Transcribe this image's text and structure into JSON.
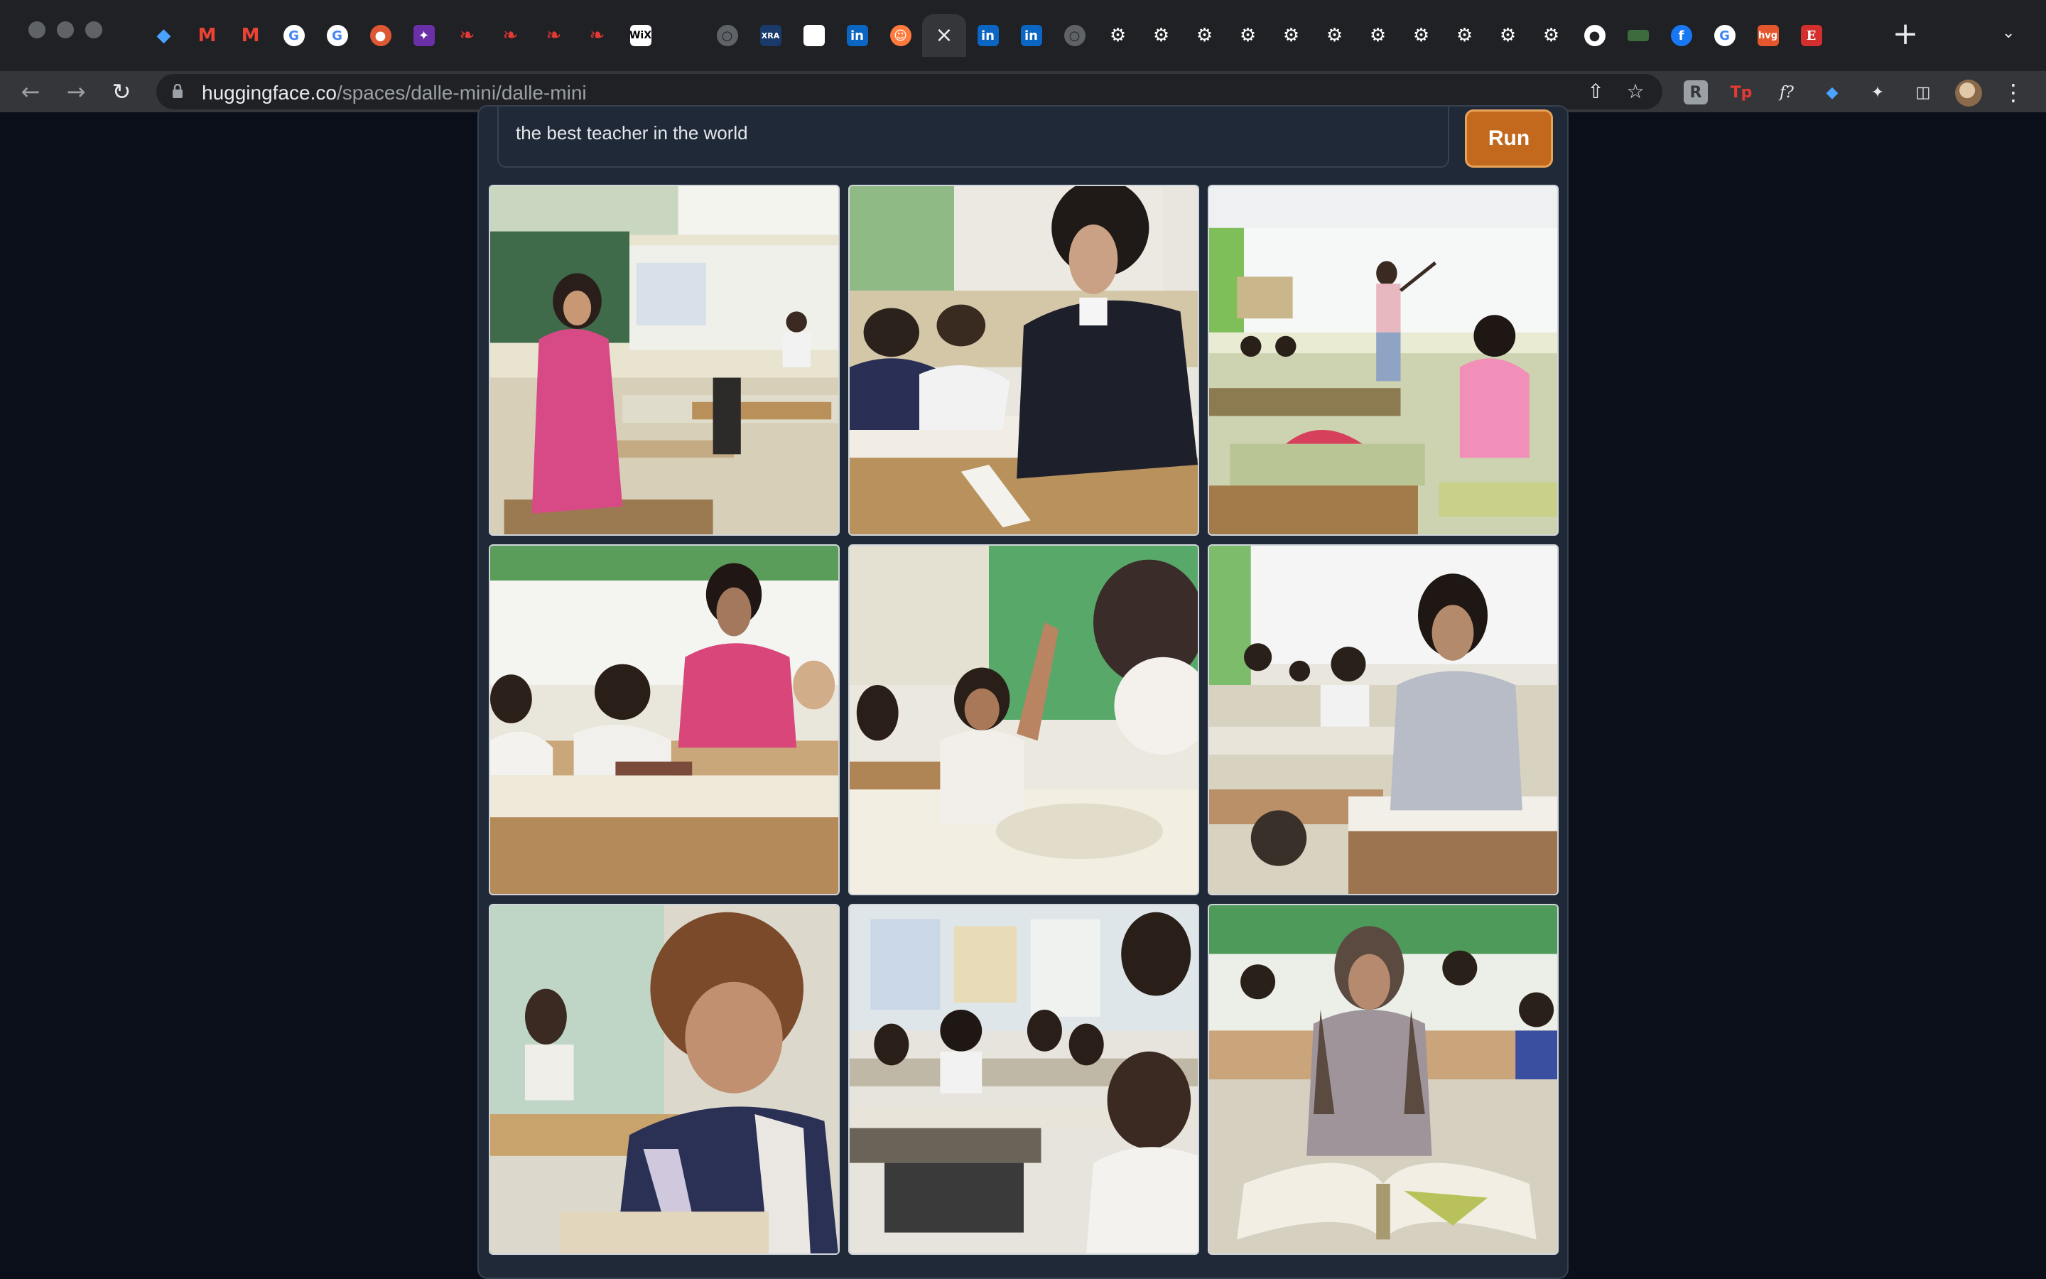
{
  "browser": {
    "tabs": [
      {
        "icon": "gem-icon"
      },
      {
        "icon": "gmail-icon"
      },
      {
        "icon": "gmail-icon"
      },
      {
        "icon": "google-icon"
      },
      {
        "icon": "google-icon"
      },
      {
        "icon": "duckduckgo-icon"
      },
      {
        "icon": "purple-app-icon"
      },
      {
        "icon": "red-bird-icon"
      },
      {
        "icon": "red-bird-icon"
      },
      {
        "icon": "red-bird-icon"
      },
      {
        "icon": "red-bird-icon"
      },
      {
        "icon": "wix-icon"
      },
      {
        "icon": "blank-icon"
      },
      {
        "icon": "globe-icon"
      },
      {
        "icon": "xra-icon"
      },
      {
        "icon": "white-square-icon"
      },
      {
        "icon": "linkedin-icon"
      },
      {
        "icon": "huggingface-icon"
      },
      {
        "icon": "close-icon",
        "active": true
      },
      {
        "icon": "linkedin-icon"
      },
      {
        "icon": "linkedin-icon"
      },
      {
        "icon": "globe-icon"
      },
      {
        "icon": "gear-icon"
      },
      {
        "icon": "gear-icon"
      },
      {
        "icon": "gear-icon"
      },
      {
        "icon": "gear-icon"
      },
      {
        "icon": "gear-icon"
      },
      {
        "icon": "gear-icon"
      },
      {
        "icon": "gear-icon"
      },
      {
        "icon": "gear-icon"
      },
      {
        "icon": "gear-icon"
      },
      {
        "icon": "gear-icon"
      },
      {
        "icon": "gear-icon"
      },
      {
        "icon": "github-icon"
      },
      {
        "icon": "green-app-icon"
      },
      {
        "icon": "facebook-icon"
      },
      {
        "icon": "google-icon"
      },
      {
        "icon": "hvg-icon"
      },
      {
        "icon": "e-icon"
      }
    ],
    "url_host": "huggingface.co",
    "url_path": "/spaces/dalle-mini/dalle-mini",
    "wix_label": "WiX",
    "xra_label": "XRA",
    "linkedin_label": "in",
    "hvg_label": "hvg",
    "e_label": "E",
    "tp_label": "Tp",
    "f_label": "f?",
    "r_label": "R"
  },
  "app": {
    "prompt_value": "the best teacher in the world",
    "run_label": "Run",
    "accent_color": "#c2691e",
    "images": [
      {
        "subject": "teacher-pink-dress-classroom"
      },
      {
        "subject": "teacher-dark-cardigan-helping-students"
      },
      {
        "subject": "teacher-writing-on-whiteboard"
      },
      {
        "subject": "teacher-pink-blouse-with-students"
      },
      {
        "subject": "student-raising-hand"
      },
      {
        "subject": "teacher-grey-cardigan-at-desk"
      },
      {
        "subject": "smiling-teacher-with-book"
      },
      {
        "subject": "students-at-desks-classroom"
      },
      {
        "subject": "teacher-reading-open-book"
      }
    ]
  }
}
